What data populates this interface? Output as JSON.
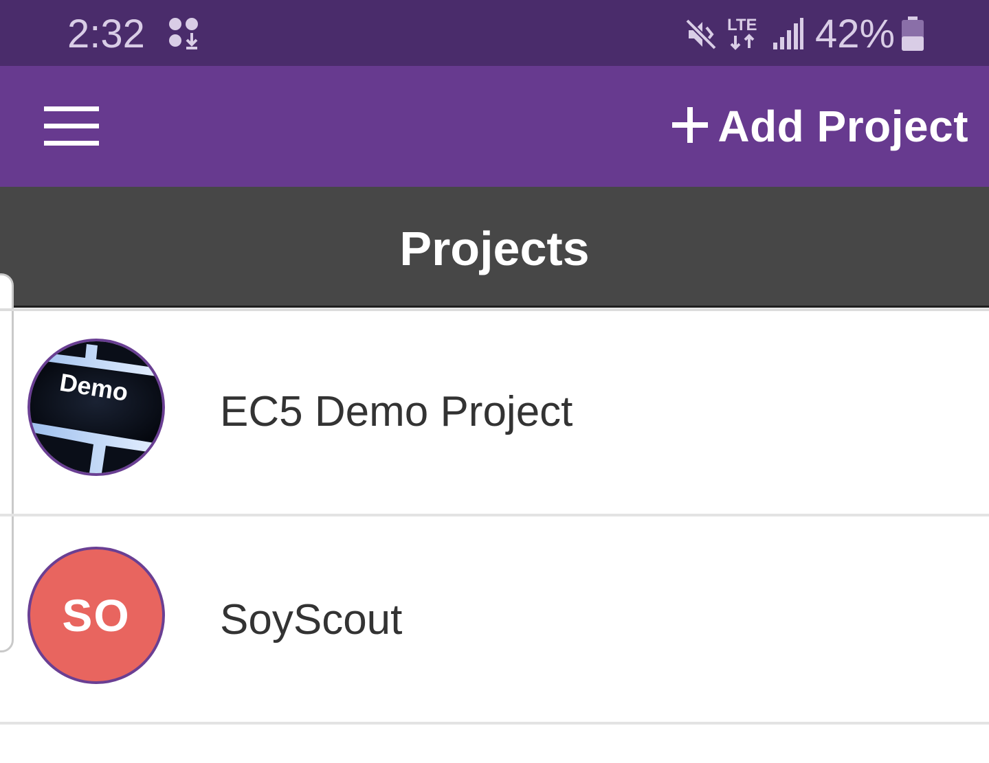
{
  "status_bar": {
    "time": "2:32",
    "battery": "42%",
    "network": "LTE",
    "icons": [
      "notification-icon",
      "mute-icon",
      "lte-icon",
      "signal-icon",
      "battery-icon"
    ]
  },
  "app_bar": {
    "menu_icon": "hamburger-menu-icon",
    "add_project_label": "Add Project",
    "add_icon": "plus-icon",
    "color": "#673a8f"
  },
  "page": {
    "title": "Projects"
  },
  "projects": [
    {
      "name": "EC5 Demo Project",
      "avatar_type": "image",
      "avatar_text": "Demo"
    },
    {
      "name": "SoyScout",
      "avatar_type": "initials",
      "avatar_text": "SO",
      "avatar_color": "#e8655f"
    }
  ]
}
